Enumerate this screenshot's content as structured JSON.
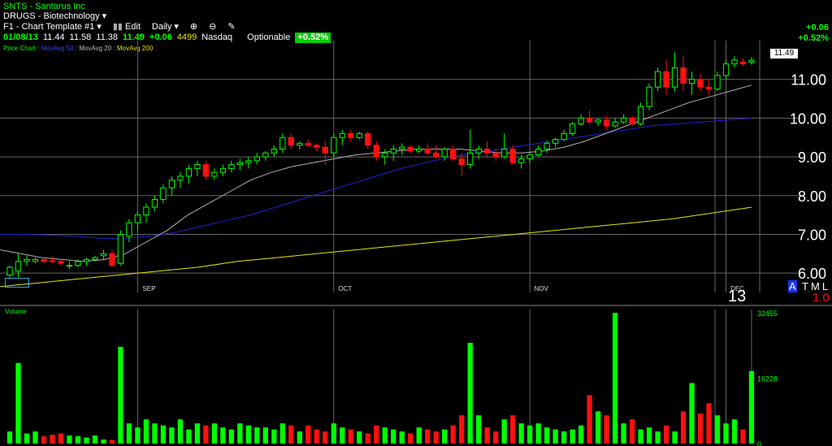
{
  "header": {
    "symbol_line": "SNTS - Santarus Inc",
    "sector": "DRUGS - Biotechnology",
    "template": "F1 - Chart Template #1",
    "edit_label": "Edit",
    "period_label": "Daily"
  },
  "quote": {
    "date": "01/08/13",
    "open": "11.44",
    "high": "11.58",
    "low": "11.38",
    "close": "11.49",
    "change": "+0.06",
    "volume": "4499",
    "exchange": "Nasdaq",
    "optionable": "Optionable",
    "pct_change": "+0.52%"
  },
  "right_change": {
    "abs": "+0.06",
    "pct": "+0.52%"
  },
  "legend": {
    "price_chart": "Price Chart",
    "ma50": "MovAvg 50",
    "ma20": "MovAvg 20",
    "ma200": "MovAvg 200",
    "volume": "Volume"
  },
  "colors": {
    "up": "#00ff00",
    "down": "#ff1010",
    "ma20": "#b0b0b0",
    "ma50": "#1e22d0",
    "ma200": "#e6e600",
    "grid": "#666666"
  },
  "price_panel_footer": {
    "label_13": "13",
    "atml": "ATML",
    "value_1_0": "1.0"
  },
  "chart_data": {
    "type": "candlestick",
    "y_ticks": [
      "11.00",
      "10.00",
      "9.00",
      "8.00",
      "7.00",
      "6.00"
    ],
    "y_tick_values": [
      11,
      10,
      9,
      8,
      7,
      6
    ],
    "ylim": [
      5.5,
      12.0
    ],
    "last_price_label": "11.49",
    "x_labels": [
      "SEP",
      "OCT",
      "NOV",
      "DEC"
    ],
    "x_label_index": [
      15,
      38,
      61,
      84
    ],
    "ohlc": [
      [
        5.95,
        6.2,
        5.85,
        6.15
      ],
      [
        6.05,
        6.5,
        5.9,
        6.3
      ],
      [
        6.3,
        6.45,
        6.2,
        6.35
      ],
      [
        6.3,
        6.4,
        6.25,
        6.35
      ],
      [
        6.35,
        6.4,
        6.25,
        6.3
      ],
      [
        6.32,
        6.42,
        6.25,
        6.3
      ],
      [
        6.3,
        6.35,
        6.2,
        6.25
      ],
      [
        6.2,
        6.3,
        6.1,
        6.2
      ],
      [
        6.2,
        6.35,
        6.15,
        6.3
      ],
      [
        6.3,
        6.4,
        6.2,
        6.35
      ],
      [
        6.35,
        6.45,
        6.3,
        6.4
      ],
      [
        6.45,
        6.6,
        6.35,
        6.5
      ],
      [
        6.5,
        6.6,
        6.15,
        6.2
      ],
      [
        6.25,
        7.1,
        6.2,
        7.0
      ],
      [
        6.95,
        7.4,
        6.8,
        7.3
      ],
      [
        7.3,
        7.6,
        7.1,
        7.5
      ],
      [
        7.5,
        7.8,
        7.3,
        7.7
      ],
      [
        7.7,
        8.0,
        7.6,
        7.9
      ],
      [
        7.9,
        8.3,
        7.8,
        8.2
      ],
      [
        8.2,
        8.5,
        8.0,
        8.4
      ],
      [
        8.4,
        8.6,
        8.2,
        8.5
      ],
      [
        8.5,
        8.8,
        8.3,
        8.7
      ],
      [
        8.7,
        8.9,
        8.5,
        8.8
      ],
      [
        8.8,
        8.9,
        8.4,
        8.5
      ],
      [
        8.5,
        8.7,
        8.4,
        8.6
      ],
      [
        8.6,
        8.8,
        8.5,
        8.7
      ],
      [
        8.7,
        8.9,
        8.6,
        8.8
      ],
      [
        8.8,
        8.95,
        8.65,
        8.85
      ],
      [
        8.85,
        9.0,
        8.7,
        8.9
      ],
      [
        8.9,
        9.1,
        8.8,
        9.0
      ],
      [
        9.0,
        9.15,
        8.9,
        9.1
      ],
      [
        9.1,
        9.3,
        9.0,
        9.2
      ],
      [
        9.2,
        9.6,
        9.1,
        9.5
      ],
      [
        9.5,
        9.6,
        9.2,
        9.3
      ],
      [
        9.3,
        9.4,
        9.2,
        9.35
      ],
      [
        9.35,
        9.45,
        9.25,
        9.3
      ],
      [
        9.3,
        9.35,
        9.15,
        9.25
      ],
      [
        9.25,
        9.4,
        8.8,
        9.1
      ],
      [
        9.1,
        9.6,
        9.0,
        9.5
      ],
      [
        9.5,
        9.7,
        9.3,
        9.6
      ],
      [
        9.6,
        9.7,
        9.4,
        9.5
      ],
      [
        9.5,
        9.65,
        9.45,
        9.6
      ],
      [
        9.6,
        9.65,
        9.2,
        9.3
      ],
      [
        9.3,
        9.4,
        8.9,
        9.0
      ],
      [
        9.0,
        9.2,
        8.8,
        9.1
      ],
      [
        9.1,
        9.3,
        8.9,
        9.2
      ],
      [
        9.2,
        9.35,
        9.05,
        9.25
      ],
      [
        9.25,
        9.3,
        9.1,
        9.15
      ],
      [
        9.15,
        9.3,
        9.1,
        9.2
      ],
      [
        9.2,
        9.35,
        9.05,
        9.1
      ],
      [
        9.1,
        9.3,
        8.95,
        9.0
      ],
      [
        9.0,
        9.25,
        8.9,
        9.2
      ],
      [
        9.2,
        9.3,
        8.9,
        8.95
      ],
      [
        8.95,
        9.1,
        8.5,
        8.8
      ],
      [
        8.8,
        9.7,
        8.7,
        9.1
      ],
      [
        9.1,
        9.3,
        8.95,
        9.2
      ],
      [
        9.2,
        9.4,
        9.0,
        9.1
      ],
      [
        9.1,
        9.2,
        8.9,
        9.0
      ],
      [
        9.0,
        9.6,
        8.95,
        9.2
      ],
      [
        9.2,
        9.3,
        8.8,
        8.85
      ],
      [
        8.85,
        9.05,
        8.7,
        8.95
      ],
      [
        8.95,
        9.1,
        8.85,
        9.05
      ],
      [
        9.05,
        9.3,
        9.0,
        9.2
      ],
      [
        9.2,
        9.4,
        9.1,
        9.35
      ],
      [
        9.35,
        9.5,
        9.25,
        9.45
      ],
      [
        9.45,
        9.7,
        9.4,
        9.6
      ],
      [
        9.6,
        9.9,
        9.55,
        9.85
      ],
      [
        9.85,
        10.1,
        9.8,
        10.0
      ],
      [
        10.0,
        10.2,
        9.85,
        9.9
      ],
      [
        9.9,
        10.0,
        9.8,
        9.95
      ],
      [
        9.95,
        10.05,
        9.7,
        9.8
      ],
      [
        9.8,
        10.0,
        9.75,
        9.9
      ],
      [
        9.9,
        10.1,
        9.85,
        10.0
      ],
      [
        10.0,
        10.05,
        9.8,
        9.85
      ],
      [
        9.85,
        10.4,
        9.8,
        10.3
      ],
      [
        10.3,
        10.9,
        10.2,
        10.8
      ],
      [
        10.8,
        11.3,
        10.7,
        11.2
      ],
      [
        11.2,
        11.5,
        10.6,
        10.8
      ],
      [
        10.8,
        11.7,
        10.7,
        11.3
      ],
      [
        11.3,
        11.6,
        10.7,
        10.9
      ],
      [
        10.9,
        11.2,
        10.6,
        11.0
      ],
      [
        11.0,
        11.15,
        10.7,
        10.8
      ],
      [
        10.8,
        11.0,
        10.6,
        10.75
      ],
      [
        10.75,
        11.2,
        10.7,
        11.1
      ],
      [
        11.1,
        11.5,
        11.0,
        11.4
      ],
      [
        11.4,
        11.6,
        11.3,
        11.5
      ],
      [
        11.45,
        11.55,
        11.35,
        11.4
      ],
      [
        11.44,
        11.58,
        11.38,
        11.49
      ]
    ],
    "volume": [
      3000,
      20000,
      2500,
      3000,
      1800,
      2200,
      2500,
      2000,
      1800,
      1500,
      2000,
      1000,
      900,
      24000,
      5000,
      4000,
      6000,
      5000,
      4500,
      4000,
      6000,
      3500,
      5000,
      4500,
      5000,
      4000,
      3500,
      5000,
      4500,
      4000,
      4000,
      3500,
      5000,
      4500,
      3000,
      4500,
      3500,
      3000,
      5000,
      4000,
      3500,
      3000,
      2500,
      4500,
      4000,
      3500,
      3000,
      2500,
      4000,
      3500,
      3000,
      3500,
      4500,
      7000,
      25000,
      7000,
      4000,
      3000,
      6000,
      7000,
      5000,
      4500,
      5000,
      4000,
      3500,
      3000,
      3500,
      4500,
      12000,
      8000,
      7000,
      32455,
      5000,
      6000,
      3500,
      4000,
      3000,
      4500,
      3000,
      8000,
      15000,
      7500,
      10000,
      7000,
      5000,
      6000,
      3500,
      18000,
      19000,
      6500,
      3000,
      4500,
      7500,
      9500,
      7500,
      5000,
      4000
    ],
    "volume_ticks": [
      "32455",
      "16228",
      "0"
    ],
    "volume_tick_values": [
      32455,
      16228,
      0
    ],
    "ma20": [
      6.6,
      6.5,
      6.4,
      6.35,
      6.3,
      6.35,
      6.5,
      6.8,
      7.1,
      7.5,
      7.8,
      8.1,
      8.4,
      8.6,
      8.75,
      8.85,
      8.95,
      9.05,
      9.1,
      9.15,
      9.2,
      9.2,
      9.2,
      9.15,
      9.1,
      9.1,
      9.15,
      9.25,
      9.4,
      9.6,
      9.8,
      10.0,
      10.2,
      10.4,
      10.55,
      10.7,
      10.85
    ],
    "ma50": [
      7.0,
      7.0,
      6.98,
      6.95,
      6.9,
      6.9,
      6.95,
      7.05,
      7.2,
      7.35,
      7.5,
      7.7,
      7.9,
      8.1,
      8.3,
      8.5,
      8.7,
      8.85,
      9.0,
      9.1,
      9.2,
      9.3,
      9.4,
      9.5,
      9.6,
      9.7,
      9.8,
      9.85,
      9.9,
      9.95,
      10.0
    ],
    "ma200": [
      5.65,
      5.75,
      5.85,
      5.95,
      6.05,
      6.15,
      6.3,
      6.4,
      6.5,
      6.6,
      6.7,
      6.8,
      6.9,
      7.0,
      7.1,
      7.2,
      7.3,
      7.4,
      7.55,
      7.7
    ]
  }
}
